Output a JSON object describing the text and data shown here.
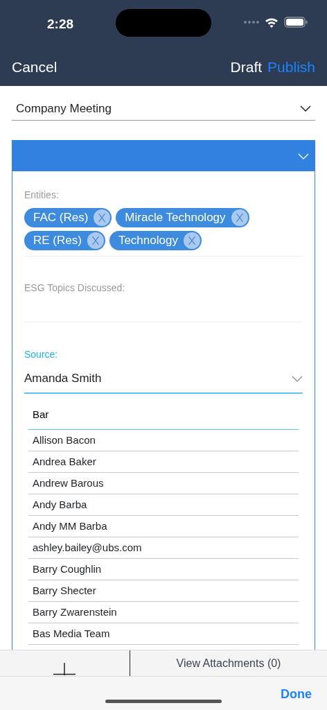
{
  "status_bar": {
    "time": "2:28"
  },
  "nav_bar": {
    "cancel": "Cancel",
    "draft": "Draft",
    "publish": "Publish"
  },
  "meeting_type": {
    "value": "Company Meeting"
  },
  "panel": {
    "expanded": true,
    "entities": {
      "label": "Entities:",
      "chips": [
        {
          "label": "FAC (Res)"
        },
        {
          "label": "Miracle Technology"
        },
        {
          "label": "RE (Res)"
        },
        {
          "label": "Technology"
        }
      ]
    },
    "esg_topics": {
      "label": "ESG Topics Discussed:"
    },
    "source": {
      "label": "Source:",
      "value": "Amanda Smith",
      "search": "Bar",
      "options": [
        "Allison Bacon",
        "Andrea Baker",
        "Andrew Barous",
        "Andy Barba",
        "Andy MM Barba",
        "ashley.bailey@ubs.com",
        "Barry Coughlin",
        "Barry Shecter",
        "Barry Zwarenstein",
        "Bas Media Team"
      ]
    }
  },
  "toolbar": {
    "attachments": "View Attachments (0)"
  },
  "keyboard_bar": {
    "done": "Done"
  }
}
